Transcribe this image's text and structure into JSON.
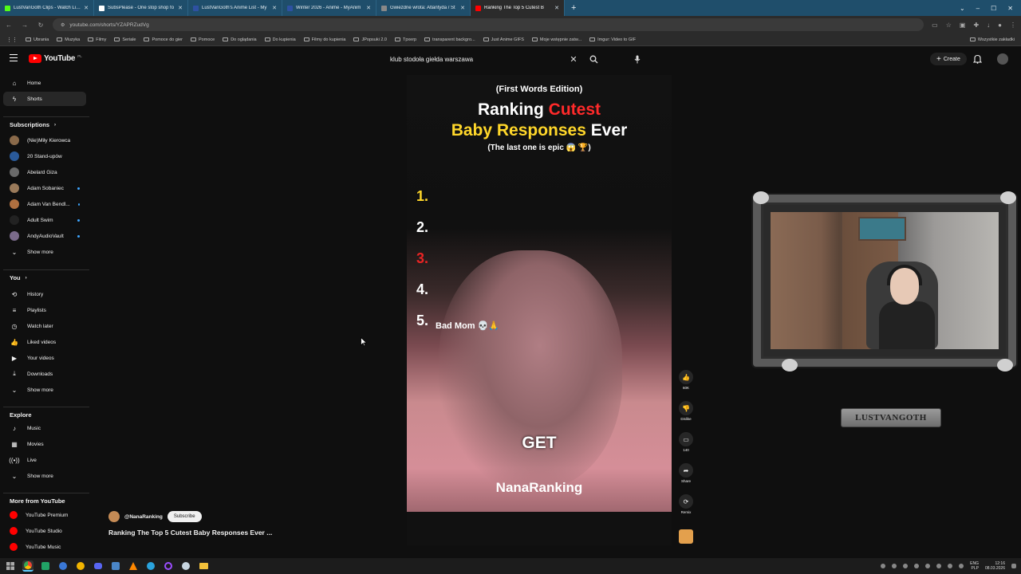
{
  "browser": {
    "tabs": [
      {
        "title": "LustVanGoth Clips - Watch Live",
        "color": "#53fc18",
        "active": false
      },
      {
        "title": "SubsPlease - One stop shop fo",
        "color": "#ffffff",
        "active": false
      },
      {
        "title": "LustVanGoth's Anime List - My",
        "color": "#2e51a2",
        "active": false
      },
      {
        "title": "Winter 2026 - Anime - MyAnim",
        "color": "#2e51a2",
        "active": false
      },
      {
        "title": "Gwiezdne wrota: Atlantyda / St",
        "color": "#888888",
        "active": false
      },
      {
        "title": "Ranking The Top 5 Cutest B",
        "color": "#ff0000",
        "active": true
      }
    ],
    "new_tab": "+",
    "url": "youtube.com/shorts/YZAPRZudVg",
    "bookmarks": [
      "Ubrania",
      "Muzyka",
      "Filmy",
      "Seriale",
      "Pomoce do gier",
      "Pomoce",
      "Do oglądania",
      "Do kupienia",
      "Filmy do kupienia",
      "JPopsuki 2.0",
      "Tpxerp",
      "transparent backgro...",
      "Just Anime GIFS",
      "Moje wstępnie zatw...",
      "Imgur: Video to GIF"
    ],
    "bookmarks_right": "Wszystkie zakładki"
  },
  "youtube": {
    "logo_text": "YouTube",
    "country_code": "PL",
    "search_query": "klub stodoła giełda warszawa",
    "create_label": "Create",
    "sidebar": {
      "main": [
        {
          "label": "Home",
          "icon": "home-icon",
          "active": false
        },
        {
          "label": "Shorts",
          "icon": "shorts-icon",
          "active": true
        }
      ],
      "subscriptions_heading": "Subscriptions",
      "subscriptions": [
        {
          "label": "(Nie)Miły Kierowca",
          "color": "#8a6a4a",
          "live": false
        },
        {
          "label": "20 Stand-upów",
          "color": "#2a5a9a",
          "live": false
        },
        {
          "label": "Abelard Giza",
          "color": "#6a6a6a",
          "live": false
        },
        {
          "label": "Adam Sobaniec",
          "color": "#9a7a5a",
          "live": true
        },
        {
          "label": "Adam Van Bendl...",
          "color": "#b07040",
          "live": true
        },
        {
          "label": "Adult Swim",
          "color": "#222222",
          "live": true
        },
        {
          "label": "AndyAudioVault",
          "color": "#7a6a8a",
          "live": true
        }
      ],
      "show_more": "Show more",
      "you_heading": "You",
      "you": [
        {
          "label": "History",
          "icon": "history-icon"
        },
        {
          "label": "Playlists",
          "icon": "playlists-icon"
        },
        {
          "label": "Watch later",
          "icon": "watch-later-icon"
        },
        {
          "label": "Liked videos",
          "icon": "liked-videos-icon"
        },
        {
          "label": "Your videos",
          "icon": "your-videos-icon"
        },
        {
          "label": "Downloads",
          "icon": "downloads-icon"
        }
      ],
      "explore_heading": "Explore",
      "explore": [
        {
          "label": "Music",
          "icon": "music-icon"
        },
        {
          "label": "Movies",
          "icon": "movies-icon"
        },
        {
          "label": "Live",
          "icon": "live-icon"
        }
      ],
      "more_heading": "More from YouTube",
      "more": [
        "YouTube Premium",
        "YouTube Studio",
        "YouTube Music"
      ]
    },
    "short": {
      "subtitle": "(First Words Edition)",
      "title_part1": "Ranking ",
      "title_highlight": "Cutest",
      "title_part2_highlight": "Baby Responses",
      "title_part2": " Ever",
      "tagline": "(The last one is epic 😱 🏆)",
      "ranks": [
        "1.",
        "2.",
        "3.",
        "4.",
        "5."
      ],
      "rank5_label": "Bad Mom 💀🙏",
      "caption": "GET",
      "watermark": "NanaRanking",
      "channel_handle": "@NanaRanking",
      "subscribe_label": "Subscribe",
      "video_title": "Ranking The Top 5 Cutest Baby Responses Ever ..."
    },
    "actions": [
      {
        "label": "60K",
        "icon": "like-icon"
      },
      {
        "label": "Dislike",
        "icon": "dislike-icon"
      },
      {
        "label": "140",
        "icon": "comment-icon"
      },
      {
        "label": "Share",
        "icon": "share-icon"
      },
      {
        "label": "Remix",
        "icon": "remix-icon"
      }
    ]
  },
  "webcam": {
    "nameplate": "LUSTVANGOTH"
  },
  "taskbar": {
    "lang1": "ENG",
    "lang2": "PLP",
    "time": "12:16",
    "date": "08.03.2026"
  }
}
